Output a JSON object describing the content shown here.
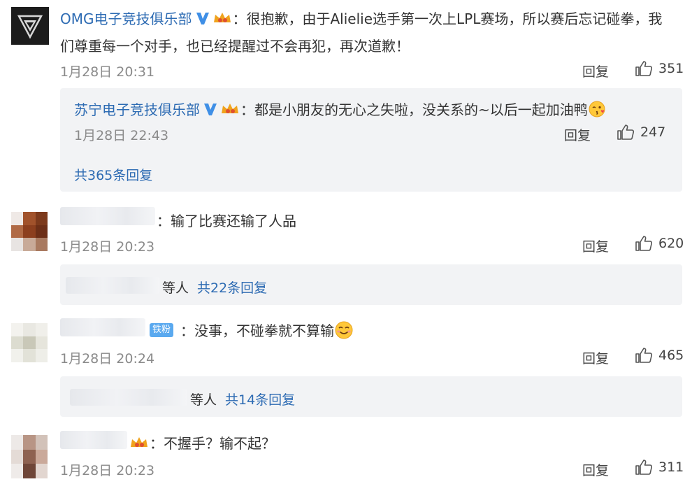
{
  "comments": [
    {
      "author": "OMG电子竞技俱乐部",
      "text_line1": "：很抱歉，由于Alielie选手第一次上LPL赛场，所以赛后忘记碰拳，我",
      "text_line2": "们尊重每一个对手，也已经提醒过不会再犯，再次道歉！",
      "time": "1月28日 20:31",
      "reply_label": "回复",
      "likes": "351",
      "sub_reply": {
        "author": "苏宁电子竞技俱乐部",
        "text": "：都是小朋友的无心之失啦，没关系的~以后一起加油鸭",
        "time": "1月28日 22:43",
        "reply_label": "回复",
        "likes": "247"
      },
      "more_replies": "共365条回复"
    },
    {
      "text": "：输了比赛还输了人品",
      "time": "1月28日 20:23",
      "reply_label": "回复",
      "likes": "620",
      "replies_prefix": "等人",
      "replies_link": "共22条回复"
    },
    {
      "fan_badge": "铁粉",
      "text": "：没事，不碰拳就不算输",
      "time": "1月28日 20:24",
      "reply_label": "回复",
      "likes": "465",
      "replies_prefix": "等人",
      "replies_link": "共14条回复"
    },
    {
      "text": "：不握手？输不起？",
      "time": "1月28日 20:23",
      "reply_label": "回复",
      "likes": "311"
    }
  ],
  "icons": {
    "verified": "verified-v-icon",
    "crown": "vip-crown-icon",
    "like": "thumbs-up-icon",
    "emoji_kiss": "kiss-emoji-icon",
    "emoji_smile": "smile-emoji-icon"
  },
  "colors": {
    "link": "#2d6bb3",
    "verified": "#3f8fe6",
    "crown": "#f0a31d",
    "panel": "#f2f3f5"
  }
}
